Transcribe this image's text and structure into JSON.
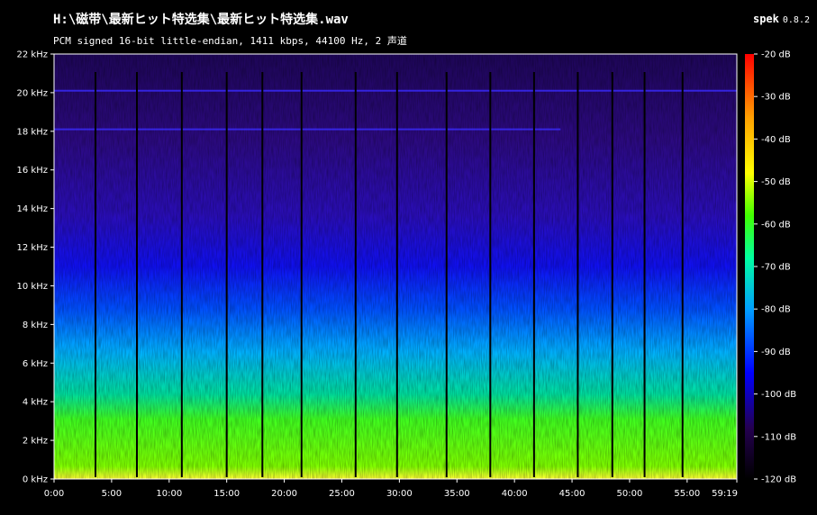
{
  "header": {
    "title": "H:\\磁带\\最新ヒット特选集\\最新ヒット特选集.wav",
    "subtitle": "PCM signed 16-bit little-endian, 1411 kbps, 44100 Hz, 2 声道",
    "app_name": "spek",
    "app_version": "0.8.2"
  },
  "chart_data": {
    "type": "heatmap",
    "x_ticks": [
      "0:00",
      "5:00",
      "10:00",
      "15:00",
      "20:00",
      "25:00",
      "30:00",
      "35:00",
      "40:00",
      "45:00",
      "50:00",
      "55:00",
      "59:19"
    ],
    "x_tick_minutes": [
      0,
      5,
      10,
      15,
      20,
      25,
      30,
      35,
      40,
      45,
      50,
      55,
      59.3167
    ],
    "xlim_minutes": [
      0,
      59.3167
    ],
    "y_ticks": [
      "0 kHz",
      "2 kHz",
      "4 kHz",
      "6 kHz",
      "8 kHz",
      "10 kHz",
      "12 kHz",
      "14 kHz",
      "16 kHz",
      "18 kHz",
      "20 kHz",
      "22 kHz"
    ],
    "y_tick_khz": [
      0,
      2,
      4,
      6,
      8,
      10,
      12,
      14,
      16,
      18,
      20,
      22
    ],
    "ylim_khz": [
      0,
      22
    ],
    "colorbar_ticks": [
      "-20 dB",
      "-30 dB",
      "-40 dB",
      "-50 dB",
      "-60 dB",
      "-70 dB",
      "-80 dB",
      "-90 dB",
      "-100 dB",
      "-110 dB",
      "-120 dB"
    ],
    "colorbar_db": [
      -20,
      -30,
      -40,
      -50,
      -60,
      -70,
      -80,
      -90,
      -100,
      -110,
      -120
    ],
    "colorbar_range_db": [
      -120,
      -20
    ],
    "track_gap_minutes": [
      3.6,
      7.2,
      11.1,
      15.0,
      18.1,
      21.5,
      26.2,
      29.8,
      34.1,
      37.9,
      41.7,
      45.5,
      48.5,
      51.3,
      54.6
    ],
    "tonal_lines": [
      {
        "khz": 18.1,
        "end_minutes": 44.0
      },
      {
        "khz": 20.1,
        "end_minutes": 59.3
      }
    ]
  }
}
